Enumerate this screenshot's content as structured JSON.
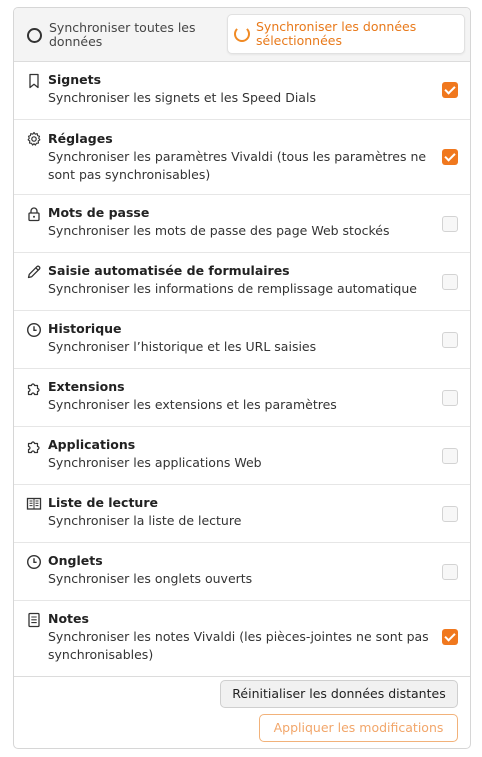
{
  "sync_mode": {
    "option_all": "Synchroniser toutes les données",
    "option_selected": "Synchroniser les données sélectionnées",
    "selected": "option_selected"
  },
  "items": [
    {
      "title": "Signets",
      "desc": "Synchroniser les signets et les Speed Dials",
      "checked": true,
      "icon": "bookmark-icon"
    },
    {
      "title": "Réglages",
      "desc": "Synchroniser les paramètres Vivaldi (tous les paramètres ne sont pas synchronisables)",
      "checked": true,
      "icon": "gear-icon"
    },
    {
      "title": "Mots de passe",
      "desc": "Synchroniser les mots de passe des page Web stockés",
      "checked": false,
      "icon": "lock-icon"
    },
    {
      "title": "Saisie automatisée de formulaires",
      "desc": "Synchroniser les informations de remplissage automatique",
      "checked": false,
      "icon": "pencil-icon"
    },
    {
      "title": "Historique",
      "desc": "Synchroniser l’historique et les URL saisies",
      "checked": false,
      "icon": "clock-icon"
    },
    {
      "title": "Extensions",
      "desc": "Synchroniser les extensions et les paramètres",
      "checked": false,
      "icon": "puzzle-icon"
    },
    {
      "title": "Applications",
      "desc": "Synchroniser les applications Web",
      "checked": false,
      "icon": "puzzle-icon"
    },
    {
      "title": "Liste de lecture",
      "desc": "Synchroniser la liste de lecture",
      "checked": false,
      "icon": "book-icon"
    },
    {
      "title": "Onglets",
      "desc": "Synchroniser les onglets ouverts",
      "checked": false,
      "icon": "clock-icon"
    },
    {
      "title": "Notes",
      "desc": "Synchroniser les notes Vivaldi (les pièces-jointes ne sont pas synchronisables)",
      "checked": true,
      "icon": "notes-icon"
    }
  ],
  "buttons": {
    "reset": "Réinitialiser les données distantes",
    "apply": "Appliquer les modifications"
  },
  "colors": {
    "accent": "#f0781e",
    "accent_text": "#e8791a",
    "disabled_accent": "#f2a66a"
  }
}
